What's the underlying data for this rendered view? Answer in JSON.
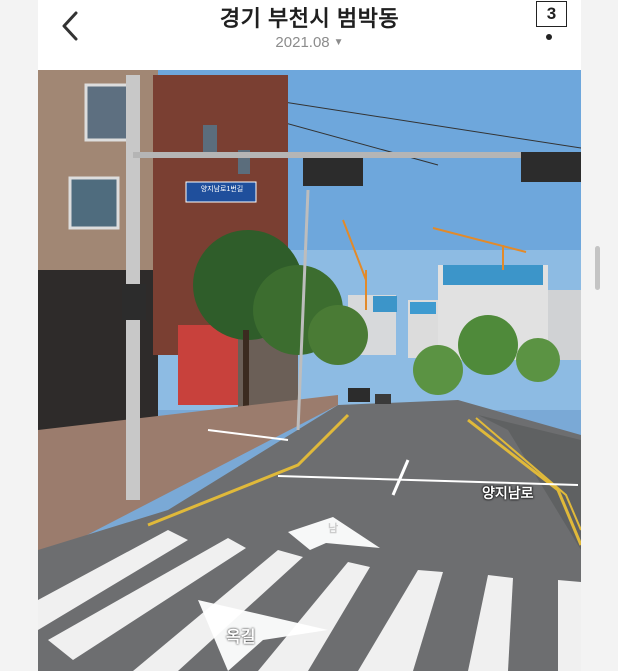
{
  "header": {
    "title": "경기 부천시 범박동",
    "date": "2021.08",
    "photo_count": "3"
  },
  "icons": {
    "back": "chevron-left-icon",
    "date_dropdown": "caret-down-icon"
  },
  "streetview": {
    "road_name": "양지남로",
    "street_sign": "양지남로1번길",
    "nav_forward_label": "남",
    "nav_back_label": "옥길"
  },
  "colors": {
    "sky": "#6ea7dc",
    "road": "#6d6e70",
    "yellow_line": "#e0b93a"
  }
}
